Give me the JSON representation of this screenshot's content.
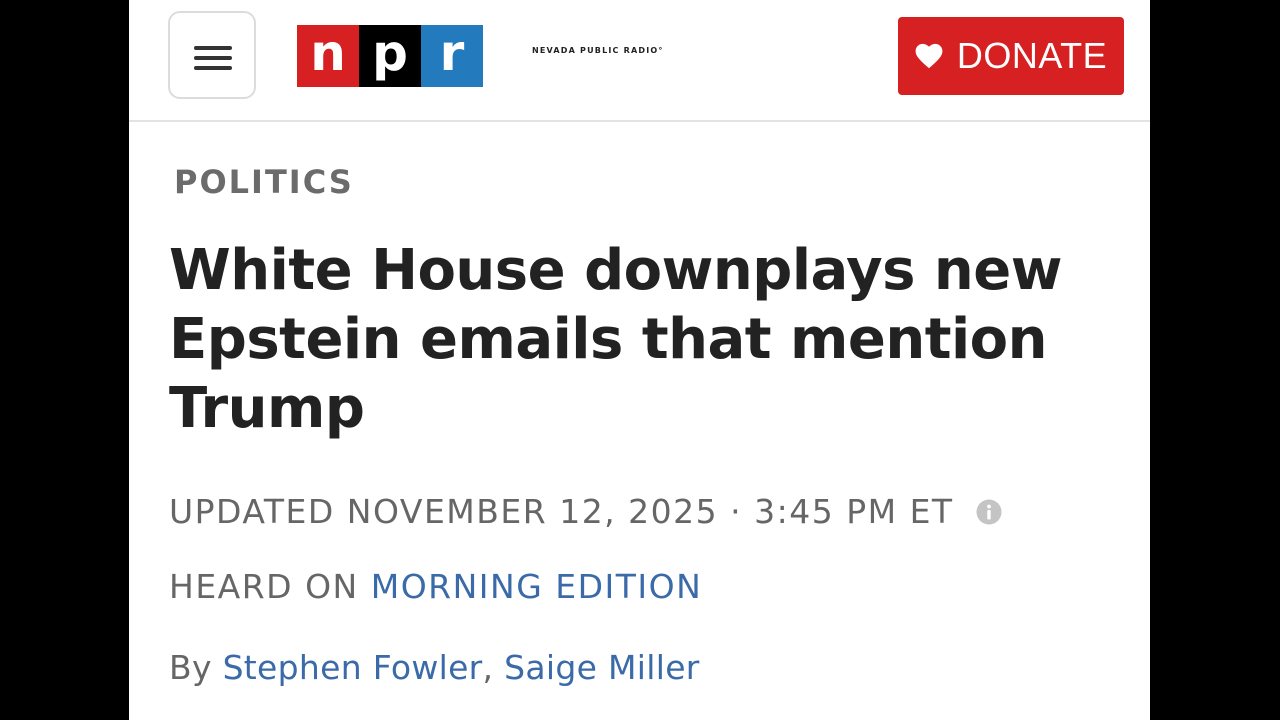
{
  "header": {
    "logo": {
      "n": "n",
      "p": "p",
      "r": "r"
    },
    "station_name": "NEVADA PUBLIC RADIO°",
    "donate_label": "DONATE"
  },
  "article": {
    "section": "POLITICS",
    "headline": "White House downplays new Epstein emails that mention Trump",
    "updated": "UPDATED NOVEMBER 12, 2025 · 3:45 PM ET",
    "heard_on_prefix": "HEARD ON ",
    "heard_on_program": "MORNING EDITION",
    "byline_prefix": "By ",
    "authors": [
      "Stephen Fowler",
      "Saige Miller"
    ],
    "author_separator": ", "
  },
  "icons": {
    "menu": "hamburger-menu-icon",
    "donate": "heart-icon",
    "updated_info": "info-icon"
  },
  "colors": {
    "npr_red": "#d62021",
    "npr_black": "#000000",
    "npr_blue": "#237bbd",
    "link_blue": "#3b6aa8",
    "meta_gray": "#666666",
    "headline": "#222222"
  }
}
